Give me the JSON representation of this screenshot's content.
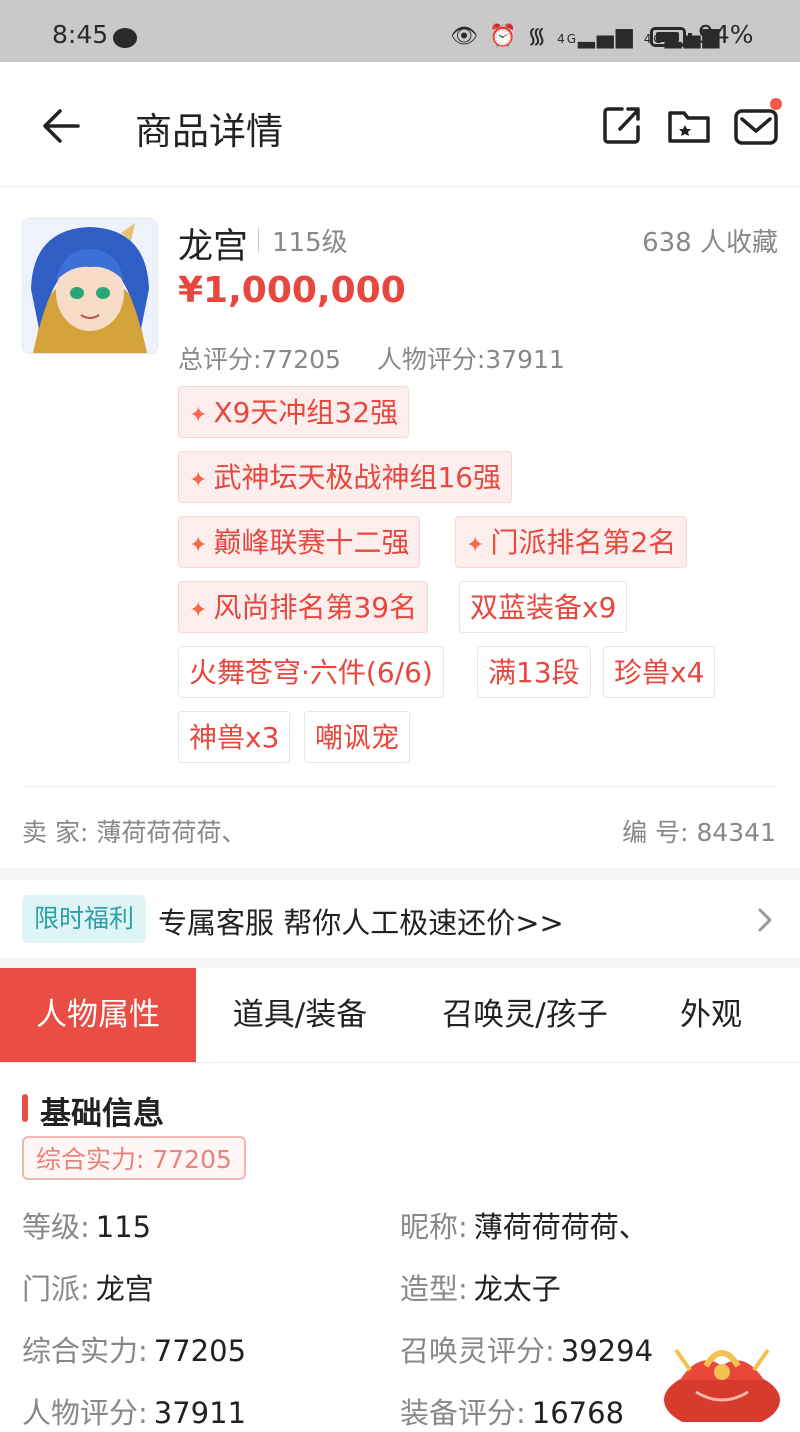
{
  "status_bar": {
    "time": "8:45",
    "battery_pct": "94%",
    "battery_level": 0.94,
    "network_1": "4G",
    "network_2": "4G"
  },
  "header": {
    "title": "商品详情"
  },
  "product": {
    "name": "龙宫",
    "level": "115级",
    "favorites": "638 人收藏",
    "price": "¥1,000,000",
    "total_score": "总评分:77205",
    "char_score": "人物评分:37911",
    "tags": [
      {
        "label": "X9天冲组32强",
        "star": true
      },
      {
        "label": "武神坛天极战神组16强",
        "star": true
      },
      {
        "label": "巅峰联赛十二强",
        "star": true
      },
      {
        "label": "门派排名第2名",
        "star": true
      },
      {
        "label": "风尚排名第39名",
        "star": true
      },
      {
        "label": "双蓝装备x9",
        "star": false
      },
      {
        "label": "火舞苍穹·六件(6/6)",
        "star": false
      },
      {
        "label": "满13段",
        "star": false
      },
      {
        "label": "珍兽x4",
        "star": false
      },
      {
        "label": "神兽x3",
        "star": false
      },
      {
        "label": "嘲讽宠",
        "star": false
      }
    ],
    "seller": "卖  家:  薄荷荷荷荷、",
    "serial": "编  号:  84341"
  },
  "promo": {
    "badge": "限时福利",
    "text": "专属客服 帮你人工极速还价>>"
  },
  "tabs": [
    {
      "label": "人物属性",
      "active": true
    },
    {
      "label": "道具/装备",
      "active": false
    },
    {
      "label": "召唤灵/孩子",
      "active": false
    },
    {
      "label": "外观",
      "active": false
    }
  ],
  "basic_info": {
    "title": "基础信息",
    "power_badge": "综合实力: 77205",
    "rows": [
      {
        "k1": "等级:",
        "v1": "115",
        "k2": "昵称:",
        "v2": "薄荷荷荷荷、"
      },
      {
        "k1": "门派:",
        "v1": "龙宫",
        "k2": "造型:",
        "v2": "龙太子"
      },
      {
        "k1": "综合实力:",
        "v1": "77205",
        "k2": "召唤灵评分:",
        "v2": "39294"
      },
      {
        "k1": "人物评分:",
        "v1": "37911",
        "k2": "装备评分:",
        "v2": "16768"
      }
    ]
  },
  "colors": {
    "accent": "#e94d44",
    "price": "#e8473d",
    "promo_badge_bg": "#dff5f5",
    "promo_badge_text": "#2aa0a8"
  }
}
